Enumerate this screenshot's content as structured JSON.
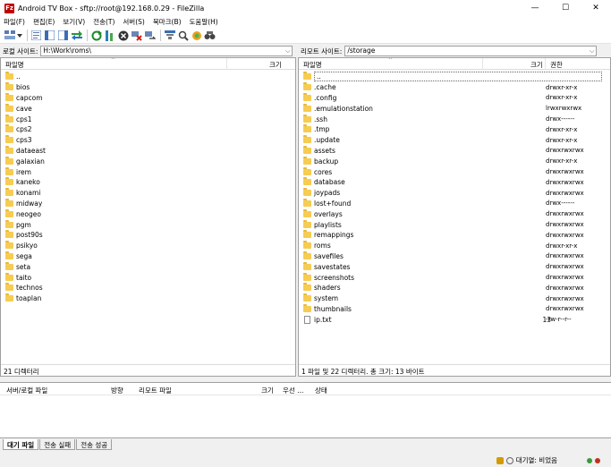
{
  "window": {
    "icon_text": "Fz",
    "title": "Android TV Box - sftp://root@192.168.0.29 - FileZilla",
    "minimize": "—",
    "maximize": "☐",
    "close": "✕"
  },
  "menu": [
    "파일(F)",
    "편집(E)",
    "보기(V)",
    "전송(T)",
    "서버(S)",
    "북마크(B)",
    "도움말(H)"
  ],
  "toolbar_icons": [
    "site-manager-icon",
    "dropdown-icon",
    "message-log-icon",
    "local-tree-icon",
    "remote-tree-icon",
    "transfer-queue-icon",
    "refresh-icon",
    "process-queue-icon",
    "cancel-icon",
    "disconnect-icon",
    "reconnect-icon",
    "filter-icon",
    "compare-icon",
    "sync-browse-icon",
    "search-icon"
  ],
  "local": {
    "site_label": "로컬 사이트:",
    "path": "H:\\Work\\roms\\",
    "headers": {
      "name": "파일명",
      "size": "크기"
    },
    "items": [
      "..",
      "bios",
      "capcom",
      "cave",
      "cps1",
      "cps2",
      "cps3",
      "dataeast",
      "galaxian",
      "irem",
      "kaneko",
      "konami",
      "midway",
      "neogeo",
      "pgm",
      "post90s",
      "psikyo",
      "sega",
      "seta",
      "taito",
      "technos",
      "toaplan"
    ],
    "status": "21 디렉터리"
  },
  "remote": {
    "site_label": "리모트 사이트:",
    "path": "/storage",
    "headers": {
      "name": "파일명",
      "size": "크기",
      "perm": "권한"
    },
    "items": [
      {
        "name": "..",
        "size": "",
        "perm": "",
        "type": "folder"
      },
      {
        "name": ".cache",
        "size": "",
        "perm": "drwxr-xr-x",
        "type": "folder"
      },
      {
        "name": ".config",
        "size": "",
        "perm": "drwxr-xr-x",
        "type": "folder"
      },
      {
        "name": ".emulationstation",
        "size": "",
        "perm": "lrwxrwxrwx",
        "type": "folder"
      },
      {
        "name": ".ssh",
        "size": "",
        "perm": "drwx------",
        "type": "folder"
      },
      {
        "name": ".tmp",
        "size": "",
        "perm": "drwxr-xr-x",
        "type": "folder"
      },
      {
        "name": ".update",
        "size": "",
        "perm": "drwxr-xr-x",
        "type": "folder"
      },
      {
        "name": "assets",
        "size": "",
        "perm": "drwxrwxrwx",
        "type": "folder"
      },
      {
        "name": "backup",
        "size": "",
        "perm": "drwxr-xr-x",
        "type": "folder"
      },
      {
        "name": "cores",
        "size": "",
        "perm": "drwxrwxrwx",
        "type": "folder"
      },
      {
        "name": "database",
        "size": "",
        "perm": "drwxrwxrwx",
        "type": "folder"
      },
      {
        "name": "joypads",
        "size": "",
        "perm": "drwxrwxrwx",
        "type": "folder"
      },
      {
        "name": "lost+found",
        "size": "",
        "perm": "drwx------",
        "type": "folder"
      },
      {
        "name": "overlays",
        "size": "",
        "perm": "drwxrwxrwx",
        "type": "folder"
      },
      {
        "name": "playlists",
        "size": "",
        "perm": "drwxrwxrwx",
        "type": "folder"
      },
      {
        "name": "remappings",
        "size": "",
        "perm": "drwxrwxrwx",
        "type": "folder"
      },
      {
        "name": "roms",
        "size": "",
        "perm": "drwxr-xr-x",
        "type": "folder"
      },
      {
        "name": "savefiles",
        "size": "",
        "perm": "drwxrwxrwx",
        "type": "folder"
      },
      {
        "name": "savestates",
        "size": "",
        "perm": "drwxrwxrwx",
        "type": "folder"
      },
      {
        "name": "screenshots",
        "size": "",
        "perm": "drwxrwxrwx",
        "type": "folder"
      },
      {
        "name": "shaders",
        "size": "",
        "perm": "drwxrwxrwx",
        "type": "folder"
      },
      {
        "name": "system",
        "size": "",
        "perm": "drwxrwxrwx",
        "type": "folder"
      },
      {
        "name": "thumbnails",
        "size": "",
        "perm": "drwxrwxrwx",
        "type": "folder"
      },
      {
        "name": "ip.txt",
        "size": "13",
        "perm": "-rw-r--r--",
        "type": "file"
      }
    ],
    "status": "1 파일 및 22 디렉터리. 총 크기: 13 바이트"
  },
  "queue": {
    "headers": {
      "server_local": "서버/로컬 파일",
      "direction": "방향",
      "remote": "리모트 파일",
      "size": "크기",
      "priority": "우선 ...",
      "status": "상태"
    }
  },
  "tabs": [
    "대기 파일",
    "전송 실패",
    "전송 성공"
  ],
  "statusbar": {
    "queue": "대기열: 비었음"
  }
}
